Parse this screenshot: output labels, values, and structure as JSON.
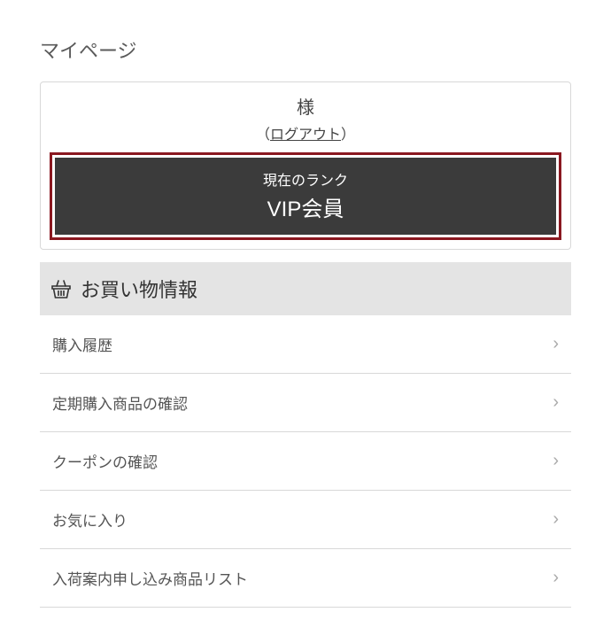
{
  "page": {
    "title": "マイページ"
  },
  "user": {
    "name_suffix": "様",
    "logout_open": "（",
    "logout_label": "ログアウト",
    "logout_close": "）"
  },
  "rank": {
    "label": "現在のランク",
    "value": "VIP会員"
  },
  "section": {
    "title": "お買い物情報"
  },
  "menu": {
    "items": [
      {
        "label": "購入履歴"
      },
      {
        "label": "定期購入商品の確認"
      },
      {
        "label": "クーポンの確認"
      },
      {
        "label": "お気に入り"
      },
      {
        "label": "入荷案内申し込み商品リスト"
      }
    ]
  }
}
